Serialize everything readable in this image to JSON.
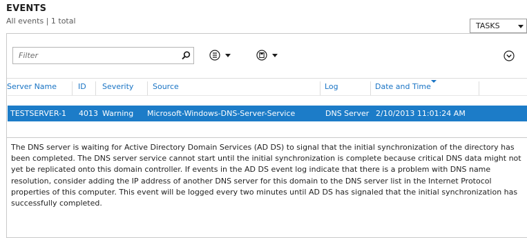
{
  "header": {
    "title": "EVENTS",
    "subtitle": "All events | 1 total",
    "tasks_label": "TASKS"
  },
  "toolbar": {
    "filter_placeholder": "Filter",
    "icons": [
      "search-icon",
      "list-options-icon",
      "save-query-icon",
      "collapse-circle-icon"
    ]
  },
  "table": {
    "columns": [
      "Server Name",
      "ID",
      "Severity",
      "Source",
      "Log",
      "Date and Time"
    ],
    "sorted_column": "Date and Time",
    "rows": [
      {
        "server": "TESTSERVER-1",
        "id": "4013",
        "severity": "Warning",
        "source": "Microsoft-Windows-DNS-Server-Service",
        "log": "DNS Server",
        "datetime": "2/10/2013 11:01:24 AM",
        "selected": true
      }
    ]
  },
  "detail": {
    "message": "The DNS server is waiting for Active Directory Domain Services (AD DS) to signal that the initial synchronization of the directory has been completed. The DNS server service cannot start until the initial synchronization is complete because critical DNS data might not yet be replicated onto this domain controller. If events in the AD DS event log indicate that there is a problem with DNS name resolution, consider adding the IP address of another DNS server for this domain to the DNS server list in the Internet Protocol properties of this computer. This event will be logged every two minutes until AD DS has signaled that the initial synchronization has successfully completed."
  },
  "colors": {
    "selection": "#1c7cc8",
    "column_header": "#1873c4"
  }
}
